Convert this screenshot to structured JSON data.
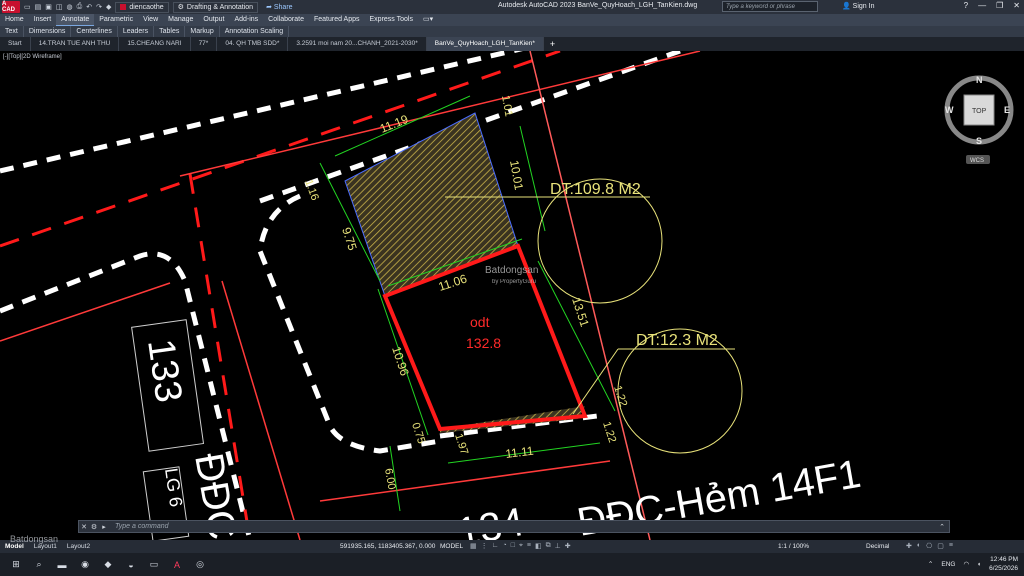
{
  "titlebar": {
    "app_badge": "A CAD",
    "workspace": "Drafting & Annotation",
    "layer_name": "diencaothe",
    "share": "Share",
    "title": "Autodesk AutoCAD 2023   BanVe_QuyHoach_LGH_TanKien.dwg",
    "search_placeholder": "Type a keyword or phrase",
    "sign_in": "Sign In"
  },
  "ribbon": {
    "tabs": [
      "Home",
      "Insert",
      "Annotate",
      "Parametric",
      "View",
      "Manage",
      "Output",
      "Add-ins",
      "Collaborate",
      "Featured Apps",
      "Express Tools"
    ],
    "active_tab": "Annotate",
    "panels": [
      "Text",
      "Dimensions",
      "Centerlines",
      "Leaders",
      "Tables",
      "Markup",
      "Annotation Scaling"
    ]
  },
  "doc_tabs": {
    "items": [
      "Start",
      "14.TRAN TUE ANH THU",
      "15.CHEANG NARI",
      "77*",
      "04. QH TMB SDD*",
      "3.2591 moi nam 20...CHANH_2021-2030*",
      "BanVe_QuyHoach_LGH_TanKien*"
    ],
    "active": "BanVe_QuyHoach_LGH_TanKien*"
  },
  "viewport": {
    "label": "[-][Top][2D Wireframe]",
    "viewcube": {
      "n": "N",
      "s": "S",
      "e": "E",
      "w": "W",
      "top": "TOP",
      "wcs": "WCS"
    },
    "dims": {
      "d1": "11.19",
      "d2": "10.01",
      "d3": "1.01",
      "d4": "1.16",
      "d5": "9.75",
      "d6": "11.06",
      "d7": "13.51",
      "d8": "10.96",
      "d9": "0.75",
      "d10": "1.97",
      "d11": "11.11",
      "d12": "1.22",
      "d13": "1.22",
      "d14": "6.00"
    },
    "area1": "DT:109.8 M2",
    "area2": "DT:12.3 M2",
    "zone_code": "odt",
    "zone_area": "132.8",
    "lot_number": "133",
    "road_lg": "LG 6",
    "road_partial": "ĐĐC",
    "road_name": "ĐĐC-Hẻm 14F1",
    "lot_partial": "134",
    "watermark_text": "Batdongsan",
    "watermark_sub": "by PropertyGuru"
  },
  "cmdline": {
    "placeholder": "Type a command"
  },
  "statusbar": {
    "tabs": [
      "Model",
      "Layout1",
      "Layout2"
    ],
    "coords": "591935.165, 1183405.367, 0.000",
    "model": "MODEL",
    "scale": "1:1 / 100%",
    "units": "Decimal"
  },
  "taskbar": {
    "lang": "ENG",
    "time": "12:46 PM",
    "date": "6/25/2026"
  },
  "colors": {
    "dim_green": "#22d422",
    "text_yellow": "#e8e27a",
    "red": "#ff1a1a",
    "white": "#ffffff",
    "hatch": "#c8b24a"
  }
}
